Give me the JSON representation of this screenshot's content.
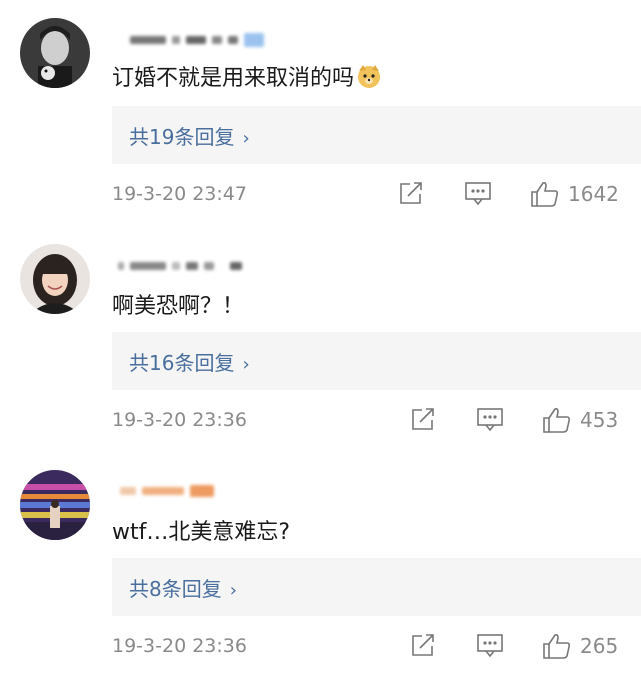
{
  "comments": [
    {
      "text": "订婚不就是用来取消的吗",
      "emoji": "🐱",
      "reply_link": "共19条回复",
      "time": "19-3-20 23:47",
      "likes": "1642"
    },
    {
      "text": "啊美恐啊？！",
      "reply_link": "共16条回复",
      "time": "19-3-20 23:36",
      "likes": "453"
    },
    {
      "text": "wtf…北美意难忘?",
      "reply_link": "共8条回复",
      "time": "19-3-20 23:36",
      "likes": "265"
    }
  ],
  "colors": {
    "link": "#4a6f9e",
    "meta": "#8a8a8a",
    "reply_bg": "#f5f5f5"
  },
  "icons": [
    "share-icon",
    "comment-icon",
    "like-icon",
    "chevron-right-icon"
  ]
}
